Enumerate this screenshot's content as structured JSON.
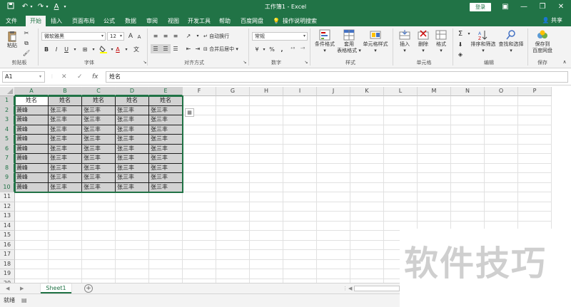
{
  "titlebar": {
    "doc_title": "工作簿1  -  Excel",
    "login": "登录",
    "quick_access": [
      "save-icon",
      "undo-icon",
      "redo-icon",
      "font-color-icon",
      "customize-icon"
    ]
  },
  "menu": {
    "tabs": [
      "文件",
      "开始",
      "插入",
      "页面布局",
      "公式",
      "数据",
      "审阅",
      "视图",
      "开发工具",
      "帮助",
      "百度网盘"
    ],
    "active_tab": "开始",
    "tell_me": "操作说明搜索",
    "share": "共享"
  },
  "ribbon": {
    "clipboard": {
      "paste": "粘贴",
      "label": "剪贴板"
    },
    "font": {
      "name": "微软雅黑",
      "size": "12",
      "bold": "B",
      "italic": "I",
      "underline": "U",
      "grow": "A",
      "shrink": "A",
      "font_color_glyph": "A",
      "label": "字体"
    },
    "alignment": {
      "wrap": "自动换行",
      "merge": "合并后居中",
      "label": "对齐方式"
    },
    "number": {
      "format": "常规",
      "percent": "%",
      "comma": ",",
      "currency": "¥",
      "label": "数字"
    },
    "styles": {
      "conditional": "条件格式",
      "table_line1": "套用",
      "table_line2": "表格格式",
      "cell": "单元格样式",
      "label": "样式"
    },
    "cells": {
      "insert": "插入",
      "delete": "删除",
      "format": "格式",
      "label": "单元格"
    },
    "editing": {
      "sort": "排序和筛选",
      "find": "查找和选择",
      "sum": "Σ",
      "label": "编辑"
    },
    "save": {
      "line1": "保存到",
      "line2": "百度网盘",
      "label": "保存"
    }
  },
  "formula_bar": {
    "name_box": "A1",
    "fx": "fx",
    "content": "姓名"
  },
  "grid": {
    "columns": [
      "A",
      "B",
      "C",
      "D",
      "E",
      "F",
      "G",
      "H",
      "I",
      "J",
      "K",
      "L",
      "M",
      "N",
      "O",
      "P"
    ],
    "rows": [
      "1",
      "2",
      "3",
      "4",
      "5",
      "6",
      "7",
      "8",
      "9",
      "10",
      "11",
      "12",
      "13",
      "14",
      "15",
      "16",
      "17",
      "18",
      "19",
      "20"
    ],
    "header_row": [
      "姓名",
      "姓名",
      "姓名",
      "姓名",
      "姓名"
    ],
    "data_rows": [
      [
        "萧峰",
        "张三丰",
        "张三丰",
        "张三丰",
        "张三丰"
      ],
      [
        "萧峰",
        "张三丰",
        "张三丰",
        "张三丰",
        "张三丰"
      ],
      [
        "萧峰",
        "张三丰",
        "张三丰",
        "张三丰",
        "张三丰"
      ],
      [
        "萧峰",
        "张三丰",
        "张三丰",
        "张三丰",
        "张三丰"
      ],
      [
        "萧峰",
        "张三丰",
        "张三丰",
        "张三丰",
        "张三丰"
      ],
      [
        "萧峰",
        "张三丰",
        "张三丰",
        "张三丰",
        "张三丰"
      ],
      [
        "萧峰",
        "张三丰",
        "张三丰",
        "张三丰",
        "张三丰"
      ],
      [
        "萧峰",
        "张三丰",
        "张三丰",
        "张三丰",
        "张三丰"
      ],
      [
        "萧峰",
        "张三丰",
        "张三丰",
        "张三丰",
        "张三丰"
      ]
    ],
    "selection": "A1:E10",
    "selection_color": "#217346"
  },
  "sheets": {
    "tabs": [
      "Sheet1"
    ],
    "active": "Sheet1"
  },
  "status": {
    "text": "就绪"
  },
  "watermark": "软件技巧",
  "colors": {
    "brand": "#217346",
    "ribbon_bg": "#f3f3f3",
    "selected_fill": "#d2d2d2"
  }
}
